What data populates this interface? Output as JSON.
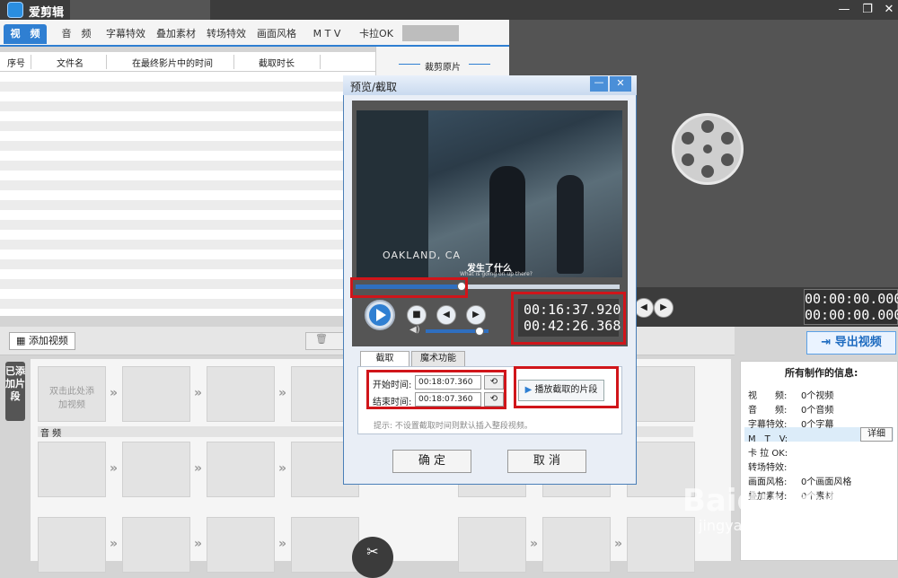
{
  "app": {
    "title": "爱剪辑"
  },
  "tabs": [
    "视　频",
    "音　频",
    "字幕特效",
    "叠加素材",
    "转场特效",
    "画面风格",
    "M T V",
    "卡拉OK"
  ],
  "table": {
    "headers": [
      "序号",
      "文件名",
      "在最终影片中的时间",
      "截取时长"
    ],
    "crop_title": "裁剪原片"
  },
  "main_preview": {
    "time_current": "00:00:00.000",
    "time_total": "00:00:00.000"
  },
  "export_label": "导出视频",
  "toolbar": {
    "add_video": "添加视频"
  },
  "side_tab": "已添加片段",
  "timeline": {
    "placeholder": "双击此处添加视频",
    "audio_label": "音 频"
  },
  "info": {
    "title": "所有制作的信息:",
    "rows": [
      {
        "k": "视　　频:",
        "v": "0个视频"
      },
      {
        "k": "音　　频:",
        "v": "0个音频"
      },
      {
        "k": "字幕特效:",
        "v": "0个字幕"
      },
      {
        "k": "M　T　V:",
        "v": ""
      },
      {
        "k": "卡 拉 OK:",
        "v": ""
      },
      {
        "k": "转场特效:",
        "v": ""
      },
      {
        "k": "画面风格:",
        "v": "0个画面风格"
      },
      {
        "k": "叠加素材:",
        "v": "0个素材"
      }
    ],
    "detail_button": "详细"
  },
  "watermark": {
    "line1": "Baidu 经验",
    "line2": "jingyan.baidu.com"
  },
  "dialog": {
    "title": "预览/截取",
    "video_sign": "OAKLAND, CA",
    "subtitle_cn": "发生了什么",
    "subtitle_en": "What is going on up there?",
    "progress": 0.4,
    "volume": 0.85,
    "time_current": "00:16:37.920",
    "time_total": "00:42:26.368",
    "tab_crop": "截取",
    "tab_magic": "魔术功能",
    "start_label": "开始时间:",
    "start_value": "00:18:07.360",
    "end_label": "结束时间:",
    "end_value": "00:18:07.360",
    "play_segment": "播放截取的片段",
    "hint": "提示: 不设置截取时间则默认插入整段视频。",
    "ok": "确 定",
    "cancel": "取 消"
  }
}
